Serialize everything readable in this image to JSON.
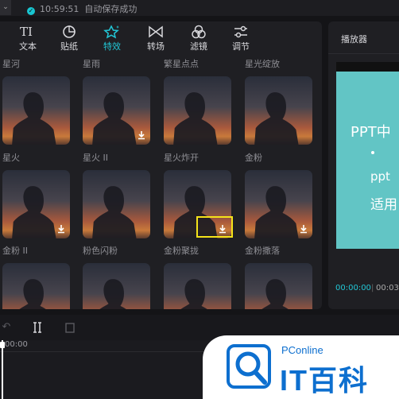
{
  "topbar": {
    "dropdown_icon": "chevron-down-icon",
    "status_time": "10:59:51",
    "status_text": "自动保存成功"
  },
  "tabs": [
    {
      "label": "文本",
      "icon": "text-icon",
      "glyph": "TI",
      "active": false
    },
    {
      "label": "贴纸",
      "icon": "sticker-icon",
      "active": false
    },
    {
      "label": "特效",
      "icon": "star-sparkle-icon",
      "active": true
    },
    {
      "label": "转场",
      "icon": "transition-icon",
      "active": false
    },
    {
      "label": "滤镜",
      "icon": "filter-icon",
      "active": false
    },
    {
      "label": "调节",
      "icon": "adjust-sliders-icon",
      "active": false
    }
  ],
  "effects": [
    {
      "name": "星河",
      "download": false
    },
    {
      "name": "星雨",
      "download": true
    },
    {
      "name": "繁星点点",
      "download": false
    },
    {
      "name": "星光绽放",
      "download": false
    },
    {
      "name": "星火",
      "download": true
    },
    {
      "name": "星火 II",
      "download": false
    },
    {
      "name": "星火炸开",
      "download": true,
      "highlighted": true
    },
    {
      "name": "金粉",
      "download": true
    },
    {
      "name": "金粉 II",
      "download": false
    },
    {
      "name": "粉色闪粉",
      "download": false
    },
    {
      "name": "金粉聚拢",
      "download": false
    },
    {
      "name": "金粉撒落",
      "download": false
    }
  ],
  "player": {
    "title": "播放器",
    "preview_line1": "PPT中",
    "preview_line2": "ppt",
    "preview_line3": "适用",
    "timecode_current": "00:00:00",
    "timecode_sep": "|",
    "timecode_total": "00:03"
  },
  "timeline": {
    "ruler_start": "00:00"
  },
  "watermark": {
    "brand": "PConline",
    "title": "IT百科"
  },
  "colors": {
    "accent": "#22c7d6",
    "highlight_box": "#f5e31a",
    "preview_bg": "#62c5c5"
  }
}
